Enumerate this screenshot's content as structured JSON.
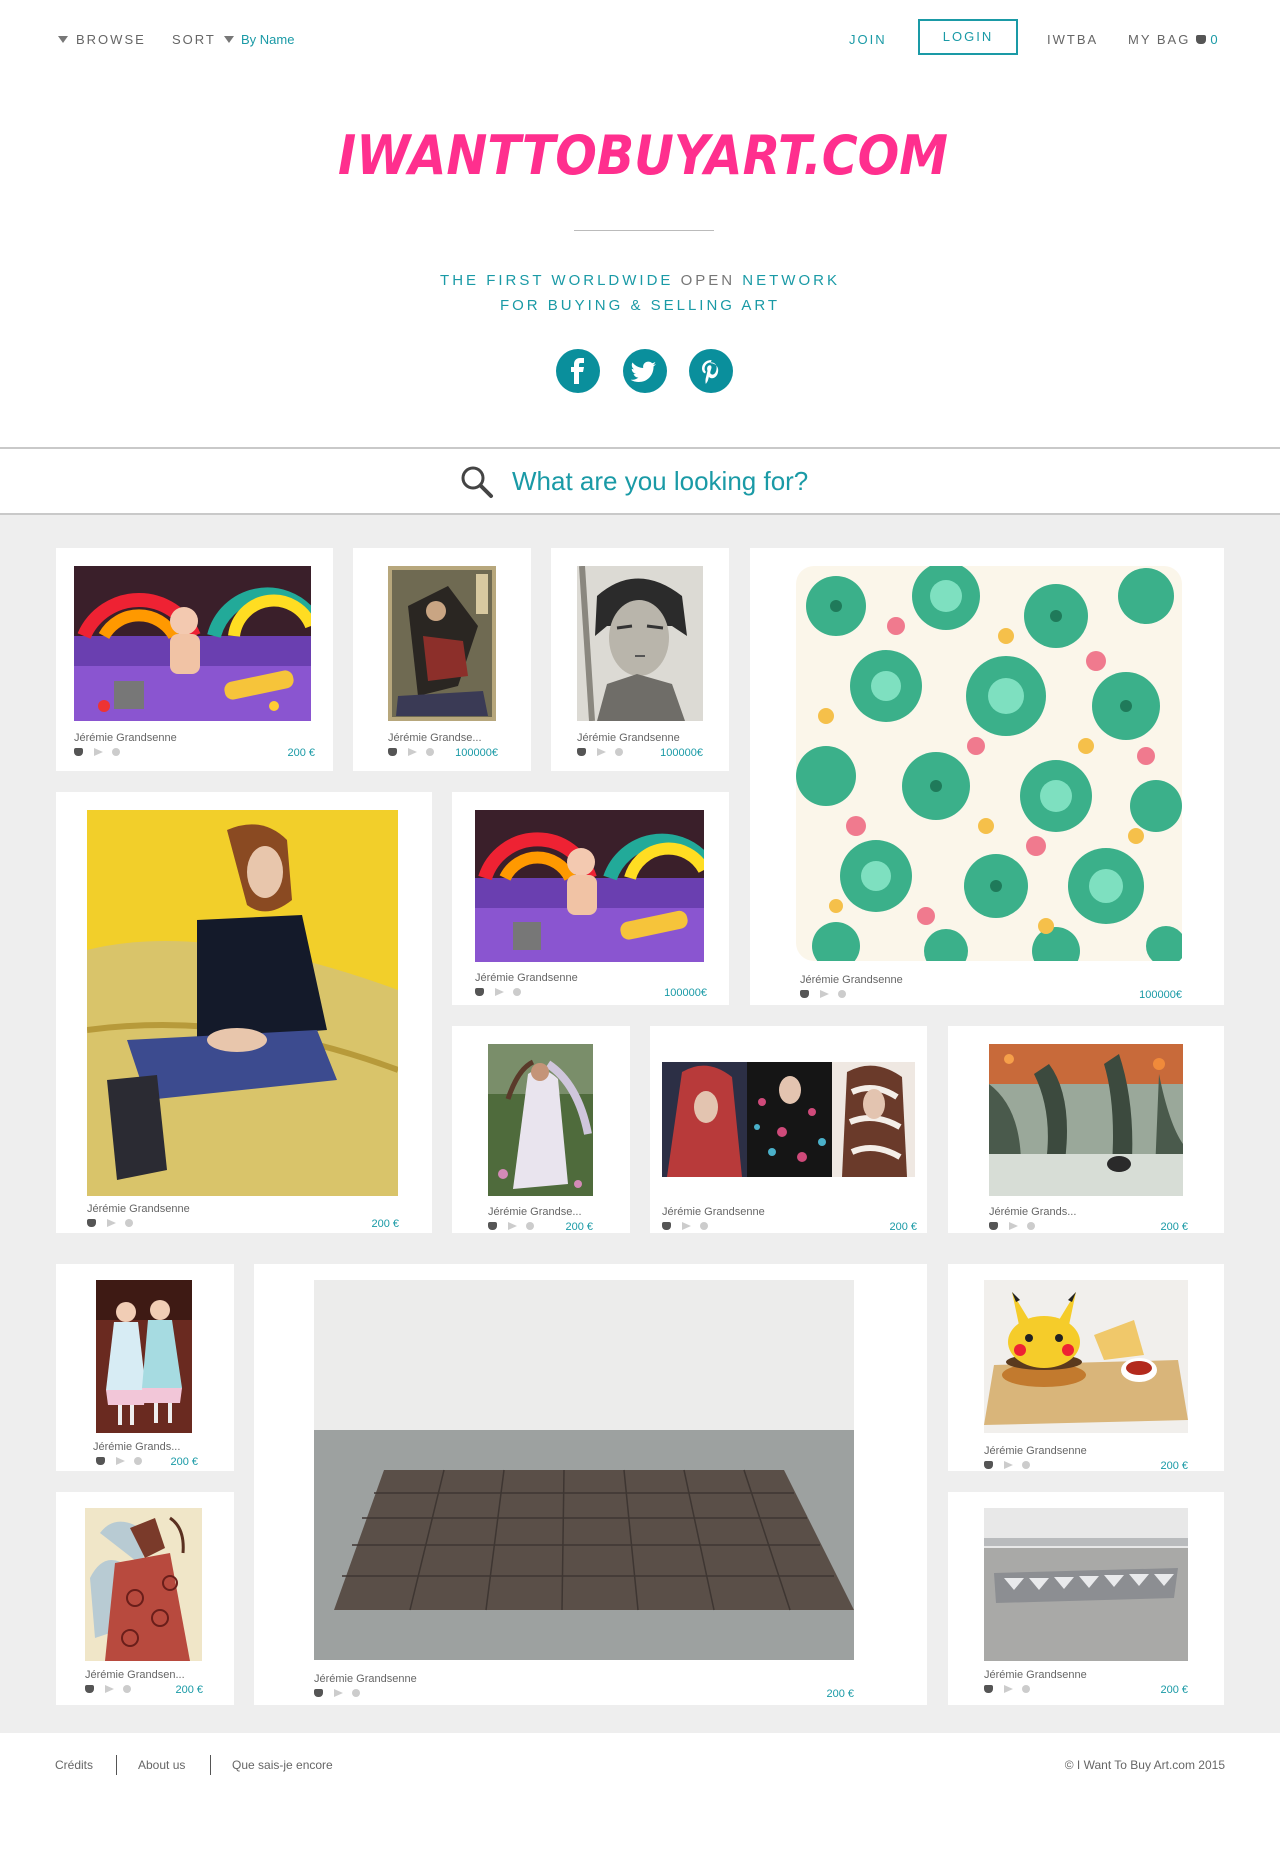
{
  "nav": {
    "browse": "BROWSE",
    "sort": "SORT",
    "sort_value": "By Name",
    "join": "JOIN",
    "login": "LOGIN",
    "iwtba": "IWTBA",
    "my_bag": "MY BAG",
    "bag_count": "0"
  },
  "logo_text": "IWANTTOBUYART.COM",
  "tagline": {
    "part1": "THE FIRST WORLDWIDE",
    "part2": "OPEN",
    "part3": "NETWORK",
    "line2": "FOR BUYING & SELLING ART"
  },
  "social": [
    "facebook-icon",
    "twitter-icon",
    "pinterest-icon"
  ],
  "colors": {
    "accent": "#1a9aa6",
    "logo": "#ff2f8e",
    "social": "#0a8f9c",
    "grid_bg": "#eeeeee"
  },
  "search": {
    "placeholder": "What are you looking for?"
  },
  "cards": [
    {
      "artist": "Jérémie Grandsenne",
      "price": "200 €"
    },
    {
      "artist": "Jérémie Grandse...",
      "price": "100000€"
    },
    {
      "artist": "Jérémie Grandsenne",
      "price": "100000€"
    },
    {
      "artist": "Jérémie Grandsenne",
      "price": "100000€"
    },
    {
      "artist": "Jérémie Grandsenne",
      "price": "200 €"
    },
    {
      "artist": "Jérémie Grandsenne",
      "price": "100000€"
    },
    {
      "artist": "Jérémie Grandse...",
      "price": "200 €"
    },
    {
      "artist": "Jérémie Grandsenne",
      "price": "200 €"
    },
    {
      "artist": "Jérémie Grands...",
      "price": "200 €"
    },
    {
      "artist": "Jérémie Grands...",
      "price": "200 €"
    },
    {
      "artist": "Jérémie Grandsenne",
      "price": "200 €"
    },
    {
      "artist": "Jérémie Grandsenne",
      "price": "200 €"
    },
    {
      "artist": "Jérémie Grandsen...",
      "price": "200 €"
    },
    {
      "artist": "Jérémie Grandsenne",
      "price": "200 €"
    }
  ],
  "footer": {
    "credits": "Crédits",
    "about": "About us",
    "other": "Que sais-je encore",
    "copyright": "© I Want To Buy Art.com 2015"
  }
}
